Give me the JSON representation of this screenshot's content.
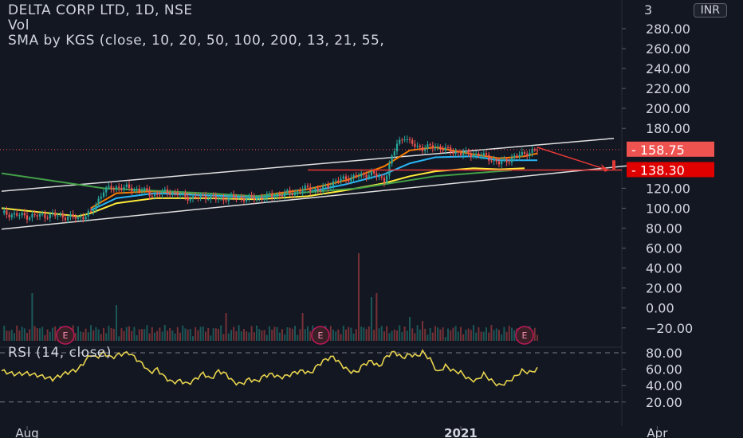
{
  "header": {
    "symbol_line": "DELTA CORP LTD, 1D, NSE",
    "vol_label": "Vol",
    "sma_line": "SMA by KGS (close, 10, 20, 50, 100, 200, 13, 21, 55,",
    "currency": "INR",
    "rsi_label": "RSI (14, close)"
  },
  "colors": {
    "background": "#131722",
    "up": "#26a69a",
    "down": "#ef5350",
    "sma_orange": "#f57c00",
    "sma_teal": "#29b6f6",
    "sma_yellow": "#ffeb3b",
    "sma_green": "#43a047",
    "channel": "#e0e0e0",
    "rsi": "#e8d44d",
    "annotation": "#e53935"
  },
  "chart_data": {
    "type": "candlestick",
    "price_axis": {
      "ticks": [
        280,
        260,
        240,
        220,
        200,
        180,
        120,
        100,
        80,
        60,
        40,
        20,
        0,
        -20
      ],
      "tick_labels": [
        "280.00",
        "260.00",
        "240.00",
        "220.00",
        "200.00",
        "180.00",
        "120.00",
        "100.00",
        "80.00",
        "60.00",
        "40.00",
        "20.00",
        "0.00",
        "−20.00"
      ],
      "partial_top_label": "3",
      "range": [
        -27,
        300
      ]
    },
    "price_markers": [
      {
        "value": 158.75,
        "label": "158.75",
        "color": "#ef5350"
      },
      {
        "value": 138.3,
        "label": "138.30",
        "color": "#e00000"
      }
    ],
    "rsi_axis": {
      "ticks": [
        80,
        60,
        40,
        20
      ],
      "tick_labels": [
        "80.00",
        "60.00",
        "40.00",
        "20.00"
      ],
      "range": [
        14,
        86
      ],
      "bands": [
        80,
        20
      ]
    },
    "time_labels": [
      {
        "label": "Aug",
        "day": 10
      },
      {
        "label": "2021",
        "day": 180
      },
      {
        "label": "Apr",
        "day": 257
      }
    ],
    "last_candle_day": 210,
    "close_anchors": [
      [
        0,
        95
      ],
      [
        10,
        92
      ],
      [
        20,
        93
      ],
      [
        30,
        90
      ],
      [
        35,
        95
      ],
      [
        40,
        118
      ],
      [
        45,
        121
      ],
      [
        50,
        120
      ],
      [
        55,
        118
      ],
      [
        60,
        113
      ],
      [
        65,
        117
      ],
      [
        70,
        113
      ],
      [
        75,
        110
      ],
      [
        80,
        112
      ],
      [
        85,
        109
      ],
      [
        90,
        111
      ],
      [
        95,
        110
      ],
      [
        100,
        110
      ],
      [
        105,
        112
      ],
      [
        110,
        114
      ],
      [
        115,
        116
      ],
      [
        120,
        120
      ],
      [
        125,
        118
      ],
      [
        130,
        126
      ],
      [
        135,
        130
      ],
      [
        140,
        132
      ],
      [
        145,
        135
      ],
      [
        150,
        128
      ],
      [
        155,
        165
      ],
      [
        158,
        172
      ],
      [
        160,
        165
      ],
      [
        165,
        160
      ],
      [
        170,
        162
      ],
      [
        175,
        158
      ],
      [
        180,
        155
      ],
      [
        185,
        154
      ],
      [
        190,
        152
      ],
      [
        195,
        145
      ],
      [
        200,
        150
      ],
      [
        205,
        155
      ],
      [
        210,
        158
      ]
    ],
    "sma_series": [
      {
        "color": "#f57c00",
        "points": [
          [
            35,
            100
          ],
          [
            45,
            115
          ],
          [
            60,
            117
          ],
          [
            80,
            113
          ],
          [
            100,
            112
          ],
          [
            120,
            119
          ],
          [
            135,
            128
          ],
          [
            150,
            142
          ],
          [
            160,
            158
          ],
          [
            170,
            161
          ],
          [
            185,
            154
          ],
          [
            195,
            150
          ],
          [
            205,
            152
          ],
          [
            210,
            155
          ]
        ]
      },
      {
        "color": "#29b6f6",
        "points": [
          [
            35,
            98
          ],
          [
            45,
            110
          ],
          [
            60,
            115
          ],
          [
            80,
            113
          ],
          [
            100,
            111
          ],
          [
            120,
            116
          ],
          [
            135,
            124
          ],
          [
            150,
            134
          ],
          [
            160,
            145
          ],
          [
            170,
            151
          ],
          [
            185,
            152
          ],
          [
            195,
            148
          ],
          [
            205,
            148
          ],
          [
            210,
            148
          ]
        ]
      },
      {
        "color": "#ffeb3b",
        "points": [
          [
            0,
            100
          ],
          [
            30,
            92
          ],
          [
            35,
            95
          ],
          [
            45,
            105
          ],
          [
            60,
            110
          ],
          [
            80,
            110
          ],
          [
            100,
            109
          ],
          [
            120,
            112
          ],
          [
            135,
            118
          ],
          [
            150,
            125
          ],
          [
            160,
            132
          ],
          [
            170,
            137
          ],
          [
            185,
            140
          ],
          [
            195,
            139
          ],
          [
            205,
            140
          ]
        ]
      },
      {
        "color": "#43a047",
        "points": [
          [
            0,
            135
          ],
          [
            40,
            120
          ],
          [
            80,
            115
          ],
          [
            100,
            112
          ],
          [
            140,
            120
          ],
          [
            170,
            132
          ],
          [
            200,
            138
          ]
        ]
      }
    ],
    "channel_lines": [
      {
        "from": [
          0,
          117
        ],
        "to": [
          240,
          170
        ]
      },
      {
        "from": [
          0,
          79
        ],
        "to": [
          255,
          145
        ]
      }
    ],
    "support_line": {
      "from_day": 120,
      "to_day": 240,
      "value": 138.3
    },
    "annotation_arrow": {
      "from": [
        210,
        161
      ],
      "to": [
        238,
        138
      ]
    },
    "annotation_box": {
      "day": 240,
      "low": 139,
      "high": 148
    },
    "earnings_markers": {
      "label": "E",
      "days": [
        25,
        125,
        205
      ]
    },
    "volume_spikes": [
      [
        12,
        60
      ],
      [
        45,
        45
      ],
      [
        88,
        35
      ],
      [
        118,
        35
      ],
      [
        140,
        110
      ],
      [
        145,
        55
      ],
      [
        147,
        60
      ],
      [
        160,
        30
      ],
      [
        165,
        25
      ]
    ],
    "rsi_series": [
      [
        0,
        58
      ],
      [
        5,
        54
      ],
      [
        10,
        55
      ],
      [
        15,
        52
      ],
      [
        20,
        48
      ],
      [
        25,
        55
      ],
      [
        30,
        60
      ],
      [
        35,
        78
      ],
      [
        37,
        74
      ],
      [
        40,
        80
      ],
      [
        43,
        74
      ],
      [
        46,
        78
      ],
      [
        50,
        80
      ],
      [
        53,
        72
      ],
      [
        56,
        64
      ],
      [
        58,
        56
      ],
      [
        61,
        60
      ],
      [
        64,
        50
      ],
      [
        67,
        44
      ],
      [
        70,
        46
      ],
      [
        73,
        42
      ],
      [
        76,
        48
      ],
      [
        79,
        55
      ],
      [
        82,
        48
      ],
      [
        85,
        58
      ],
      [
        88,
        54
      ],
      [
        91,
        44
      ],
      [
        94,
        42
      ],
      [
        97,
        48
      ],
      [
        100,
        45
      ],
      [
        103,
        52
      ],
      [
        106,
        54
      ],
      [
        109,
        50
      ],
      [
        112,
        52
      ],
      [
        115,
        56
      ],
      [
        118,
        58
      ],
      [
        121,
        55
      ],
      [
        124,
        65
      ],
      [
        127,
        72
      ],
      [
        130,
        75
      ],
      [
        133,
        66
      ],
      [
        136,
        58
      ],
      [
        139,
        56
      ],
      [
        142,
        66
      ],
      [
        145,
        70
      ],
      [
        148,
        63
      ],
      [
        151,
        76
      ],
      [
        154,
        81
      ],
      [
        157,
        74
      ],
      [
        160,
        78
      ],
      [
        163,
        76
      ],
      [
        165,
        81
      ],
      [
        168,
        72
      ],
      [
        171,
        56
      ],
      [
        174,
        64
      ],
      [
        177,
        58
      ],
      [
        180,
        56
      ],
      [
        183,
        48
      ],
      [
        186,
        46
      ],
      [
        189,
        54
      ],
      [
        192,
        46
      ],
      [
        195,
        40
      ],
      [
        198,
        44
      ],
      [
        201,
        50
      ],
      [
        204,
        58
      ],
      [
        207,
        56
      ],
      [
        210,
        60
      ]
    ]
  }
}
